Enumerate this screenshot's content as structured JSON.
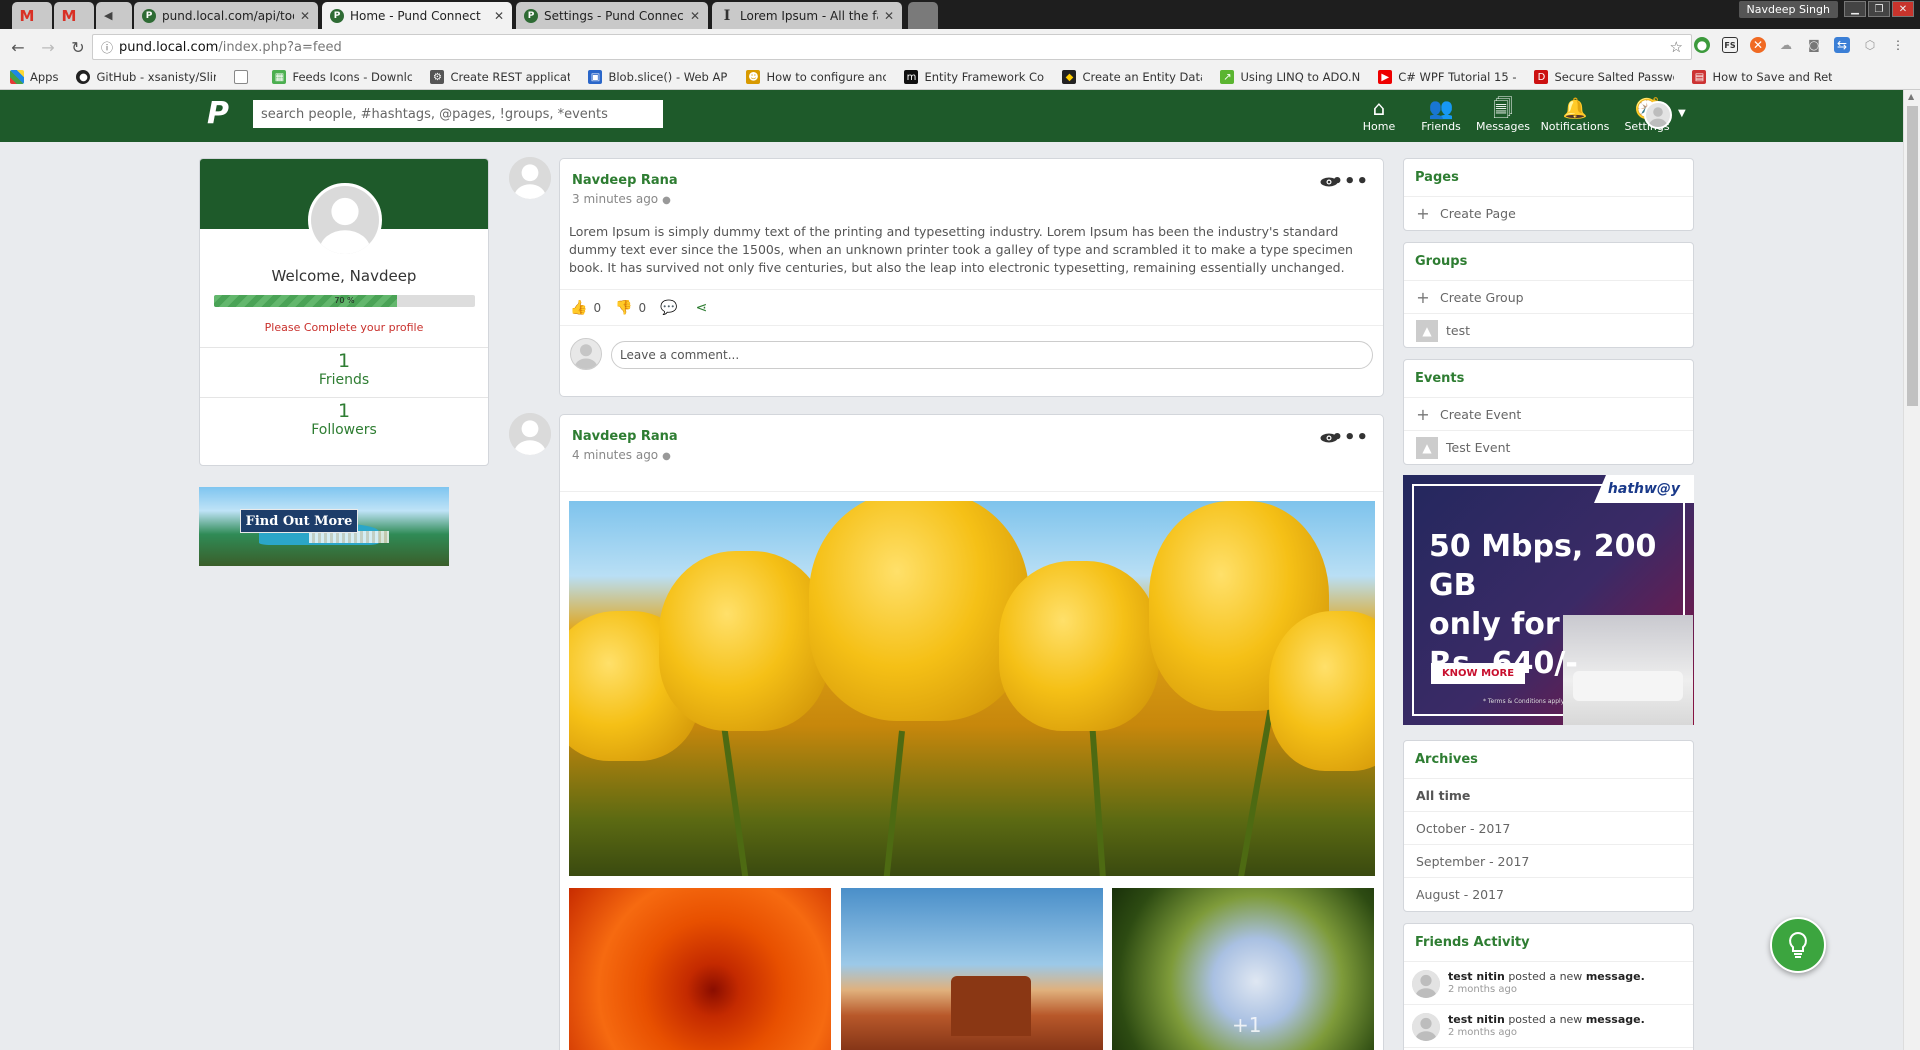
{
  "browser": {
    "tabs": [
      {
        "label": "",
        "icon": "gmail-icon",
        "active": false
      },
      {
        "label": "",
        "icon": "gmail-icon",
        "active": false
      },
      {
        "label": "pund.local.com/api/todo",
        "icon": "pund-icon",
        "active": false
      },
      {
        "label": "Home - Pund Connect",
        "icon": "pund-icon",
        "active": true
      },
      {
        "label": "Settings - Pund Connect",
        "icon": "pund-icon",
        "active": false
      },
      {
        "label": "Lorem Ipsum - All the fa",
        "icon": "lorem-icon",
        "active": false
      }
    ],
    "user_chip": "Navdeep Singh",
    "url_host": "pund.local.com",
    "url_path": "/index.php?a=feed",
    "bookmarks": [
      {
        "label": "Apps",
        "icon": "apps-icon",
        "color": "#d44"
      },
      {
        "label": "GitHub - xsanisty/Slin",
        "icon": "github-icon",
        "color": "#222"
      },
      {
        "label": "",
        "icon": "page-icon",
        "color": "#888"
      },
      {
        "label": "Feeds Icons - Downlc",
        "icon": "feeds-icon",
        "color": "#4caf50"
      },
      {
        "label": "Create REST applicati",
        "icon": "rest-icon",
        "color": "#555"
      },
      {
        "label": "Blob.slice() - Web API",
        "icon": "blob-icon",
        "color": "#2a66c9"
      },
      {
        "label": "How to configure anc",
        "icon": "config-icon",
        "color": "#d89a00"
      },
      {
        "label": "Entity Framework Cor",
        "icon": "ef-icon",
        "color": "#111"
      },
      {
        "label": "Create an Entity Data",
        "icon": "entity-icon",
        "color": "#222"
      },
      {
        "label": "Using LINQ to ADO.N",
        "icon": "linq-icon",
        "color": "#5bb531"
      },
      {
        "label": "C# WPF Tutorial 15 -",
        "icon": "youtube-icon",
        "color": "#e00"
      },
      {
        "label": "Secure Salted Passwo",
        "icon": "secure-icon",
        "color": "#c11"
      },
      {
        "label": "How to Save and Ret",
        "icon": "pdf-icon",
        "color": "#c33"
      }
    ]
  },
  "header": {
    "search_placeholder": "search people, #hashtags, @pages, !groups, *events",
    "nav": {
      "home": "Home",
      "friends": "Friends",
      "messages": "Messages",
      "notifications": "Notifications",
      "settings": "Settings"
    }
  },
  "profile": {
    "welcome": "Welcome, Navdeep",
    "progress_label": "70 %",
    "progress_value": 0.7,
    "complete_link": "Please Complete your profile",
    "friends_count": "1",
    "friends_label": "Friends",
    "followers_count": "1",
    "followers_label": "Followers"
  },
  "ad_left": {
    "button": "Find Out More"
  },
  "posts": [
    {
      "author": "Navdeep Rana",
      "time": "3 minutes ago",
      "text": "Lorem Ipsum is simply dummy text of the printing and typesetting industry. Lorem Ipsum has been the industry's standard dummy text ever since the 1500s, when an unknown printer took a galley of type and scrambled it to make a type specimen book. It has survived not only five centuries, but also the leap into electronic typesetting, remaining essentially unchanged.",
      "likes": "0",
      "dislikes": "0",
      "comment_placeholder": "Leave a comment..."
    },
    {
      "author": "Navdeep Rana",
      "time": "4 minutes ago",
      "more_images": "+1"
    }
  ],
  "sidebar": {
    "pages": {
      "title": "Pages",
      "create": "Create Page"
    },
    "groups": {
      "title": "Groups",
      "create": "Create Group",
      "items": [
        "test"
      ]
    },
    "events": {
      "title": "Events",
      "create": "Create Event",
      "items": [
        "Test Event"
      ]
    },
    "archives": {
      "title": "Archives",
      "items": [
        "All time",
        "October - 2017",
        "September - 2017",
        "August - 2017"
      ]
    },
    "friends_activity": {
      "title": "Friends Activity",
      "items": [
        {
          "name": "test nitin",
          "action": "posted a new",
          "object": "message.",
          "ago": "2 months ago"
        },
        {
          "name": "test nitin",
          "action": "posted a new",
          "object": "message.",
          "ago": "2 months ago"
        }
      ]
    }
  },
  "ad_right": {
    "brand": "hathw@y",
    "headline_1": "50 Mbps, 200 GB",
    "headline_2": "only for",
    "headline_3": "Rs. 640/-",
    "cta": "KNOW MORE",
    "tnc": "* Terms & Conditions apply"
  },
  "colors": {
    "brand_green": "#1e5a2a",
    "link_green": "#2e7d32",
    "warn_red": "#c9302c"
  }
}
